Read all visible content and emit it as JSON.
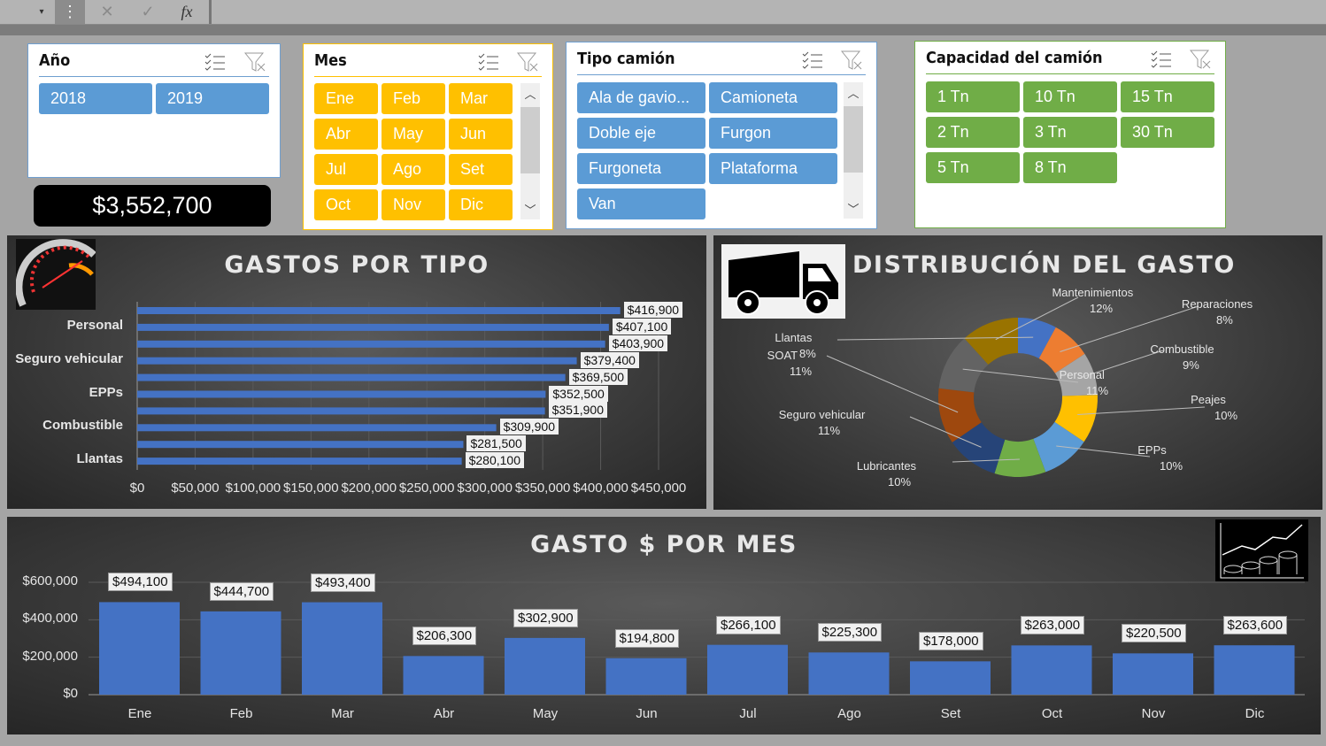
{
  "formula_bar": {
    "cancel_icon": "x-icon",
    "enter_icon": "check-icon",
    "function_label": "fx"
  },
  "slicers": {
    "year": {
      "title": "Año",
      "items": [
        "2018",
        "2019"
      ],
      "color": "#5b9bd5"
    },
    "month": {
      "title": "Mes",
      "items": [
        "Ene",
        "Feb",
        "Mar",
        "Abr",
        "May",
        "Jun",
        "Jul",
        "Ago",
        "Set",
        "Oct",
        "Nov",
        "Dic"
      ],
      "color": "#ffc000"
    },
    "truck_type": {
      "title": "Tipo camión",
      "items": [
        "Ala de gavio...",
        "Camioneta",
        "Doble eje",
        "Furgon",
        "Furgoneta",
        "Plataforma",
        "Van"
      ],
      "color": "#5b9bd5"
    },
    "capacity": {
      "title": "Capacidad del camión",
      "items": [
        "1 Tn",
        "10 Tn",
        "15 Tn",
        "2 Tn",
        "3 Tn",
        "30 Tn",
        "5 Tn",
        "8 Tn"
      ],
      "color": "#70ad47"
    }
  },
  "total": "$3,552,700",
  "chart_data": [
    {
      "type": "bar",
      "orientation": "horizontal",
      "title": "GASTOS POR TIPO",
      "tick_labels": [
        "",
        "Personal",
        "",
        "Seguro vehicular",
        "",
        "EPPs",
        "",
        "Combustible",
        "",
        "Llantas"
      ],
      "values": [
        416900,
        407100,
        403900,
        379400,
        369500,
        352500,
        351900,
        309900,
        281500,
        280100
      ],
      "data_labels": [
        "$416,900",
        "$407,100",
        "$403,900",
        "$379,400",
        "$369,500",
        "$352,500",
        "$351,900",
        "$309,900",
        "$281,500",
        "$280,100"
      ],
      "x_ticks": [
        "$0",
        "$50,000",
        "$100,000",
        "$150,000",
        "$200,000",
        "$250,000",
        "$300,000",
        "$350,000",
        "$400,000",
        "$450,000"
      ],
      "xlim": [
        0,
        450000
      ],
      "grid": true,
      "color": "#4472c4"
    },
    {
      "type": "pie",
      "donut": true,
      "title": "DISTRIBUCIÓN DEL GASTO",
      "slices": [
        {
          "label": "Llantas",
          "pct": "8%",
          "value": 280100,
          "color": "#4472c4"
        },
        {
          "label": "Reparaciones",
          "pct": "8%",
          "value": 281500,
          "color": "#ed7d31"
        },
        {
          "label": "Combustible",
          "pct": "9%",
          "value": 309900,
          "color": "#a5a5a5"
        },
        {
          "label": "Peajes",
          "pct": "10%",
          "value": 351900,
          "color": "#ffc000"
        },
        {
          "label": "EPPs",
          "pct": "10%",
          "value": 352500,
          "color": "#5b9bd5"
        },
        {
          "label": "Lubricantes",
          "pct": "10%",
          "value": 369500,
          "color": "#70ad47"
        },
        {
          "label": "Seguro vehicular",
          "pct": "11%",
          "value": 379400,
          "color": "#264478"
        },
        {
          "label": "SOAT",
          "pct": "11%",
          "value": 403900,
          "color": "#9e480e"
        },
        {
          "label": "Personal",
          "pct": "11%",
          "value": 407100,
          "color": "#636363"
        },
        {
          "label": "Mantenimientos",
          "pct": "12%",
          "value": 416900,
          "color": "#997300"
        }
      ]
    },
    {
      "type": "bar",
      "title": "GASTO $ POR MES",
      "categories": [
        "Ene",
        "Feb",
        "Mar",
        "Abr",
        "May",
        "Jun",
        "Jul",
        "Ago",
        "Set",
        "Oct",
        "Nov",
        "Dic"
      ],
      "values": [
        494100,
        444700,
        493400,
        206300,
        302900,
        194800,
        266100,
        225300,
        178000,
        263000,
        220500,
        263600
      ],
      "data_labels": [
        "$494,100",
        "$444,700",
        "$493,400",
        "$206,300",
        "$302,900",
        "$194,800",
        "$266,100",
        "$225,300",
        "$178,000",
        "$263,000",
        "$220,500",
        "$263,600"
      ],
      "y_ticks": [
        "$0",
        "$200,000",
        "$400,000",
        "$600,000"
      ],
      "ylim": [
        0,
        600000
      ],
      "grid": true,
      "color": "#4472c4"
    }
  ]
}
